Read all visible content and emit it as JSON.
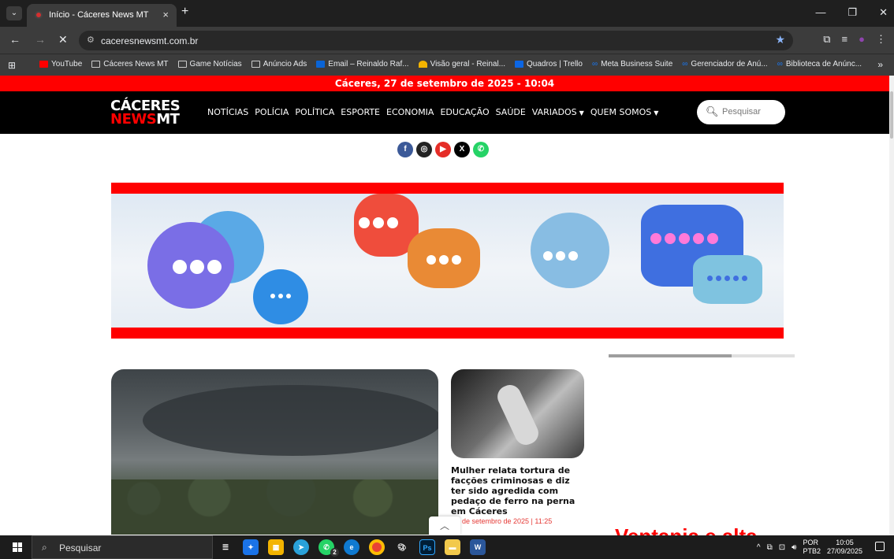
{
  "browser": {
    "tab_title": "Início - Cáceres News MT",
    "url": "caceresnewsmt.com.br",
    "tab_close": "×",
    "new_tab": "+",
    "bookmarks": [
      {
        "label": "YouTube",
        "icon": "youtube-icon"
      },
      {
        "label": "Cáceres News MT",
        "icon": "folder-icon"
      },
      {
        "label": "Game Notícias",
        "icon": "folder-icon"
      },
      {
        "label": "Anúncio Ads",
        "icon": "folder-icon"
      },
      {
        "label": "Email – Reinaldo Raf...",
        "icon": "outlook-icon"
      },
      {
        "label": "Visão geral - Reinal...",
        "icon": "google-ads-icon"
      },
      {
        "label": "Quadros | Trello",
        "icon": "trello-icon"
      },
      {
        "label": "Meta Business Suite",
        "icon": "meta-icon"
      },
      {
        "label": "Gerenciador de Anú...",
        "icon": "meta-icon"
      },
      {
        "label": "Biblioteca de Anúnc...",
        "icon": "meta-icon"
      }
    ]
  },
  "site": {
    "date_bar": "Cáceres, 27 de setembro de 2025 - 10:04",
    "logo_line1": "CÁCERES",
    "logo_news": "NEWS",
    "logo_mt": "MT",
    "nav": [
      {
        "label": "NOTÍCIAS"
      },
      {
        "label": "POLÍCIA"
      },
      {
        "label": "POLÍTICA"
      },
      {
        "label": "ESPORTE"
      },
      {
        "label": "ECONOMIA"
      },
      {
        "label": "EDUCAÇÃO"
      },
      {
        "label": "SAÚDE"
      },
      {
        "label": "VARIADOS",
        "dropdown": true
      },
      {
        "label": "QUEM SOMOS",
        "dropdown": true
      }
    ],
    "search_placeholder": "Pesquisar",
    "social": [
      {
        "name": "facebook-icon",
        "glyph": "f",
        "color": "#3b5998"
      },
      {
        "name": "instagram-icon",
        "glyph": "◎",
        "color": "#222222"
      },
      {
        "name": "youtube-icon",
        "glyph": "▶",
        "color": "#e52d27"
      },
      {
        "name": "x-icon",
        "glyph": "X",
        "color": "#000000"
      },
      {
        "name": "whatsapp-icon",
        "glyph": "✆",
        "color": "#25d366"
      }
    ],
    "slider_progress": 0.66,
    "small_card_title": "Mulher relata tortura de facções criminosas e diz ter sido agredida com pedaço de ferro na perna em Cáceres",
    "small_card_date": "de setembro de 2025 | 11:25",
    "partial_headline": "Ventania e alta"
  },
  "taskbar": {
    "search_label": "Pesquisar",
    "lang_top": "POR",
    "lang_bottom": "PTB2",
    "time": "10:05",
    "date": "27/09/2025",
    "whatsapp_badge": "2",
    "ps_label": "Ps",
    "word_label": "W"
  },
  "colors": {
    "brand_red": "#ff0000",
    "header_black": "#000000"
  }
}
